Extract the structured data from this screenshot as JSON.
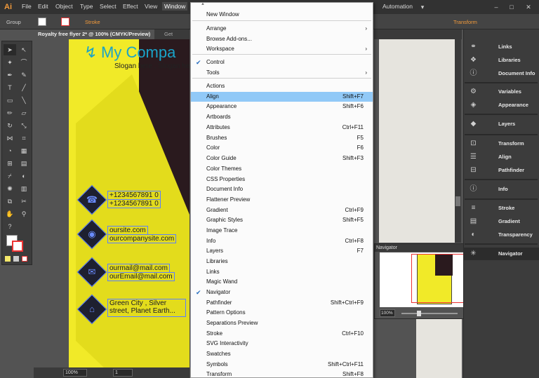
{
  "app": {
    "logo": "Ai"
  },
  "menubar": {
    "items": [
      "File",
      "Edit",
      "Object",
      "Type",
      "Select",
      "Effect",
      "View",
      "Window"
    ],
    "active": "Window",
    "automation": "Automation"
  },
  "controlbar": {
    "selection": "Group",
    "stroke_label": "Stroke",
    "transform_label": "Transform"
  },
  "tabs": {
    "active": "Royalty free flyer 2* @ 100% (CMYK/Preview)",
    "inactive": "Get Royal"
  },
  "flyer": {
    "company": "My Compa",
    "slogan": "Slogan here , Slogan he",
    "phone1": "+1234567891 0",
    "phone2": "+1234567891 0",
    "web1": "oursite.com",
    "web2": "ourcompanysite.com",
    "mail1": "ourmail@mail.com",
    "mail2": "ourEmail@mail.com",
    "addr1": "Green City , Silver",
    "addr2": "street, Planet Earth..."
  },
  "window_menu": {
    "items": [
      {
        "label": "New Window",
        "shortcut": "",
        "submenu": false,
        "checked": false
      },
      {
        "label": "Arrange",
        "shortcut": "",
        "submenu": true,
        "checked": false
      },
      {
        "label": "Browse Add-ons...",
        "shortcut": "",
        "submenu": false,
        "checked": false
      },
      {
        "label": "Workspace",
        "shortcut": "",
        "submenu": true,
        "checked": false
      },
      {
        "label": "Control",
        "shortcut": "",
        "submenu": false,
        "checked": true
      },
      {
        "label": "Tools",
        "shortcut": "",
        "submenu": true,
        "checked": false
      },
      {
        "label": "Actions",
        "shortcut": "",
        "submenu": false,
        "checked": false
      },
      {
        "label": "Align",
        "shortcut": "Shift+F7",
        "submenu": false,
        "checked": false,
        "highlighted": true
      },
      {
        "label": "Appearance",
        "shortcut": "Shift+F6",
        "submenu": false,
        "checked": false
      },
      {
        "label": "Artboards",
        "shortcut": "",
        "submenu": false,
        "checked": false
      },
      {
        "label": "Attributes",
        "shortcut": "Ctrl+F11",
        "submenu": false,
        "checked": false
      },
      {
        "label": "Brushes",
        "shortcut": "F5",
        "submenu": false,
        "checked": false
      },
      {
        "label": "Color",
        "shortcut": "F6",
        "submenu": false,
        "checked": false
      },
      {
        "label": "Color Guide",
        "shortcut": "Shift+F3",
        "submenu": false,
        "checked": false
      },
      {
        "label": "Color Themes",
        "shortcut": "",
        "submenu": false,
        "checked": false
      },
      {
        "label": "CSS Properties",
        "shortcut": "",
        "submenu": false,
        "checked": false
      },
      {
        "label": "Document Info",
        "shortcut": "",
        "submenu": false,
        "checked": false
      },
      {
        "label": "Flattener Preview",
        "shortcut": "",
        "submenu": false,
        "checked": false
      },
      {
        "label": "Gradient",
        "shortcut": "Ctrl+F9",
        "submenu": false,
        "checked": false
      },
      {
        "label": "Graphic Styles",
        "shortcut": "Shift+F5",
        "submenu": false,
        "checked": false
      },
      {
        "label": "Image Trace",
        "shortcut": "",
        "submenu": false,
        "checked": false
      },
      {
        "label": "Info",
        "shortcut": "Ctrl+F8",
        "submenu": false,
        "checked": false
      },
      {
        "label": "Layers",
        "shortcut": "F7",
        "submenu": false,
        "checked": false
      },
      {
        "label": "Libraries",
        "shortcut": "",
        "submenu": false,
        "checked": false
      },
      {
        "label": "Links",
        "shortcut": "",
        "submenu": false,
        "checked": false
      },
      {
        "label": "Magic Wand",
        "shortcut": "",
        "submenu": false,
        "checked": false
      },
      {
        "label": "Navigator",
        "shortcut": "",
        "submenu": false,
        "checked": true
      },
      {
        "label": "Pathfinder",
        "shortcut": "Shift+Ctrl+F9",
        "submenu": false,
        "checked": false
      },
      {
        "label": "Pattern Options",
        "shortcut": "",
        "submenu": false,
        "checked": false
      },
      {
        "label": "Separations Preview",
        "shortcut": "",
        "submenu": false,
        "checked": false
      },
      {
        "label": "Stroke",
        "shortcut": "Ctrl+F10",
        "submenu": false,
        "checked": false
      },
      {
        "label": "SVG Interactivity",
        "shortcut": "",
        "submenu": false,
        "checked": false
      },
      {
        "label": "Swatches",
        "shortcut": "",
        "submenu": false,
        "checked": false
      },
      {
        "label": "Symbols",
        "shortcut": "Shift+Ctrl+F11",
        "submenu": false,
        "checked": false
      },
      {
        "label": "Transform",
        "shortcut": "Shift+F8",
        "submenu": false,
        "checked": false
      }
    ]
  },
  "navigator": {
    "title": "Navigator",
    "zoom": "100%"
  },
  "statusbar": {
    "zoom": "100%",
    "page": "1"
  },
  "dock": {
    "items": [
      {
        "label": "Links",
        "icon": "links-icon"
      },
      {
        "label": "Libraries",
        "icon": "libraries-icon"
      },
      {
        "label": "Document Info",
        "icon": "document-info-icon"
      },
      {
        "label": "Variables",
        "icon": "variables-icon"
      },
      {
        "label": "Appearance",
        "icon": "appearance-icon"
      },
      {
        "label": "Layers",
        "icon": "layers-icon"
      },
      {
        "label": "Transform",
        "icon": "transform-icon"
      },
      {
        "label": "Align",
        "icon": "align-icon"
      },
      {
        "label": "Pathfinder",
        "icon": "pathfinder-icon"
      },
      {
        "label": "Info",
        "icon": "info-icon"
      },
      {
        "label": "Stroke",
        "icon": "stroke-icon"
      },
      {
        "label": "Gradient",
        "icon": "gradient-icon"
      },
      {
        "label": "Transparency",
        "icon": "transparency-icon"
      },
      {
        "label": "Navigator",
        "icon": "navigator-icon"
      }
    ]
  },
  "colors": {
    "menu_highlight": "#91c9f7",
    "flyer_yellow": "#f1ea28",
    "accent_orange": "#f29a3b",
    "company_blue": "#1aa3c8"
  }
}
